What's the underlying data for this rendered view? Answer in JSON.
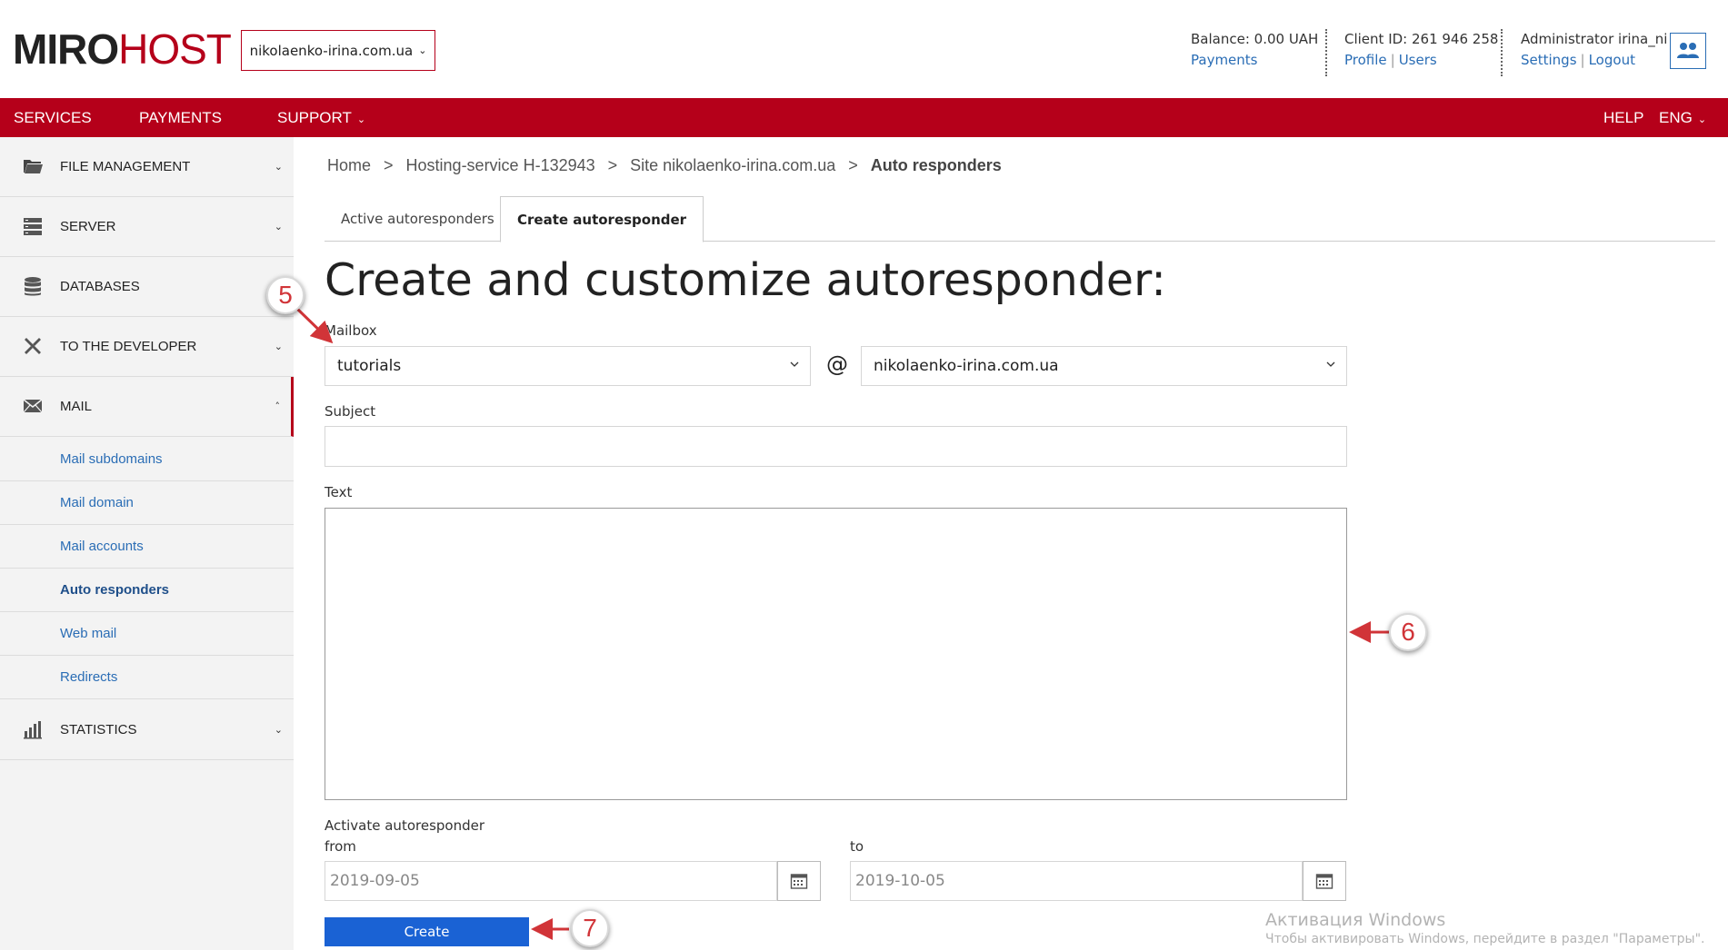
{
  "header": {
    "logo_part1": "MIRO",
    "logo_part2": "HOST",
    "domain_selector": "nikolaenko-irina.com.ua",
    "balance": "Balance: 0.00 UAH",
    "payments_link": "Payments",
    "client_id": "Client ID: 261 946 258",
    "profile_link": "Profile",
    "users_link": "Users",
    "separator": "|",
    "admin": "Administrator irina_ni",
    "settings_link": "Settings",
    "logout_link": "Logout",
    "user_icon": "users-icon"
  },
  "navbar": {
    "items": [
      {
        "label": "SERVICES"
      },
      {
        "label": "PAYMENTS"
      },
      {
        "label": "SUPPORT"
      },
      {
        "label": "HELP"
      },
      {
        "label": "ENG"
      }
    ],
    "accent": "#b5001a"
  },
  "sidebar": {
    "items": [
      {
        "label": "FILE MANAGEMENT",
        "icon": "folder-icon"
      },
      {
        "label": "SERVER",
        "icon": "server-icon"
      },
      {
        "label": "DATABASES",
        "icon": "database-icon"
      },
      {
        "label": "TO THE DEVELOPER",
        "icon": "tools-icon"
      },
      {
        "label": "MAIL",
        "icon": "envelope-icon"
      },
      {
        "label": "STATISTICS",
        "icon": "bar-chart-icon"
      }
    ],
    "mail_subitems": [
      {
        "label": "Mail subdomains"
      },
      {
        "label": "Mail domain"
      },
      {
        "label": "Mail accounts"
      },
      {
        "label": "Auto responders"
      },
      {
        "label": "Web mail"
      },
      {
        "label": "Redirects"
      }
    ]
  },
  "breadcrumb": {
    "items": [
      "Home",
      "Hosting-service H-132943",
      "Site nikolaenko-irina.com.ua",
      "Auto responders"
    ],
    "arrow": ">"
  },
  "tabs": [
    {
      "label": "Active autoresponders"
    },
    {
      "label": "Create autoresponder"
    }
  ],
  "form": {
    "title": "Create and customize autoresponder:",
    "mailbox_label": "Mailbox",
    "mailbox_value": "tutorials",
    "at_sign": "@",
    "domain_value": "nikolaenko-irina.com.ua",
    "subject_label": "Subject",
    "subject_value": "",
    "text_label": "Text",
    "text_value": "",
    "activate_label": "Activate autoresponder",
    "from_label": "from",
    "from_date": "2019-09-05",
    "to_label": "to",
    "to_date": "2019-10-05",
    "create_button": "Create",
    "button_color": "#1a62d4"
  },
  "annotations": [
    "5",
    "6",
    "7"
  ],
  "watermark": {
    "line1": "Активация Windows",
    "line2": "Чтобы активировать Windows, перейдите в раздел \"Параметры\"."
  }
}
